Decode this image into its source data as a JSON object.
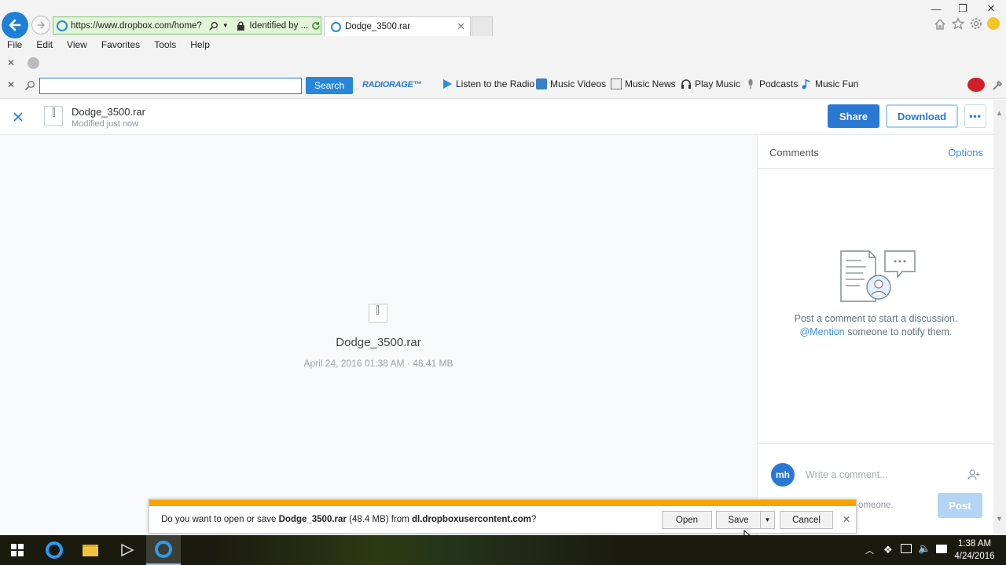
{
  "browser": {
    "address_url": "https://www.dropbox.com/home?",
    "identity": "Identified by ...",
    "tab_title": "Dodge_3500.rar",
    "menu": [
      "File",
      "Edit",
      "View",
      "Favorites",
      "Tools",
      "Help"
    ],
    "toolbar": {
      "search_placeholder": "",
      "search_button": "Search",
      "brand": "RADIORAGE™",
      "links": [
        "Listen to the Radio",
        "Music Videos",
        "Music News",
        "Play Music",
        "Podcasts",
        "Music Fun"
      ]
    }
  },
  "dropbox": {
    "file_name": "Dodge_3500.rar",
    "file_status": "Modified just now",
    "share_label": "Share",
    "download_label": "Download",
    "more_label": "•••",
    "preview": {
      "file_name": "Dodge_3500.rar",
      "meta": "April 24, 2016 01:38 AM · 48.41 MB"
    },
    "comments": {
      "title": "Comments",
      "options": "Options",
      "empty_line1": "Post a comment to start a discussion.",
      "mention": "@Mention",
      "empty_line2": " someone to notify them.",
      "avatar": "mh",
      "input_placeholder": "Write a comment...",
      "hint": "omeone.",
      "post_label": "Post"
    }
  },
  "download_dialog": {
    "prefix": "Do you want to open or save ",
    "file": "Dodge_3500.rar",
    "size": " (48.4 MB) from ",
    "source": "dl.dropboxusercontent.com",
    "suffix": "?",
    "open_label": "Open",
    "save_label": "Save",
    "cancel_label": "Cancel"
  },
  "taskbar": {
    "time": "1:38 AM",
    "date": "4/24/2016"
  },
  "colors": {
    "dropbox_blue": "#2a78d4",
    "ie_blue": "#1e7fd6",
    "notification_bar": "#f5a400",
    "address_secure": "#e3f5d8"
  }
}
